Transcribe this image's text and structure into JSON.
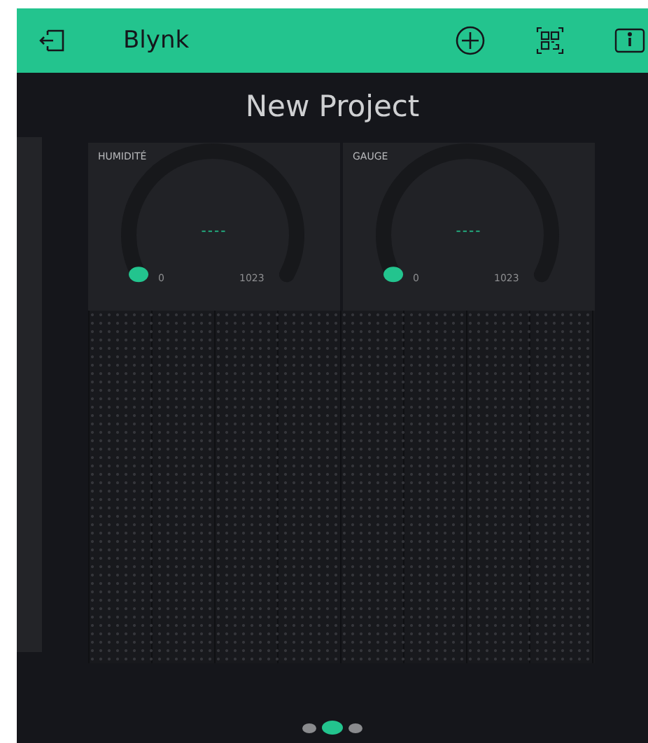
{
  "header": {
    "title": "Blynk"
  },
  "project": {
    "title": "New Project"
  },
  "widgets": [
    {
      "kind": "gauge",
      "label": "HUMIDITÉ",
      "value": "----",
      "min": "0",
      "max": "1023"
    },
    {
      "kind": "gauge",
      "label": "GAUGE",
      "value": "----",
      "min": "0",
      "max": "1023"
    }
  ],
  "page_indicator": [
    {
      "selected": false
    },
    {
      "selected": true
    },
    {
      "selected": false
    }
  ]
}
